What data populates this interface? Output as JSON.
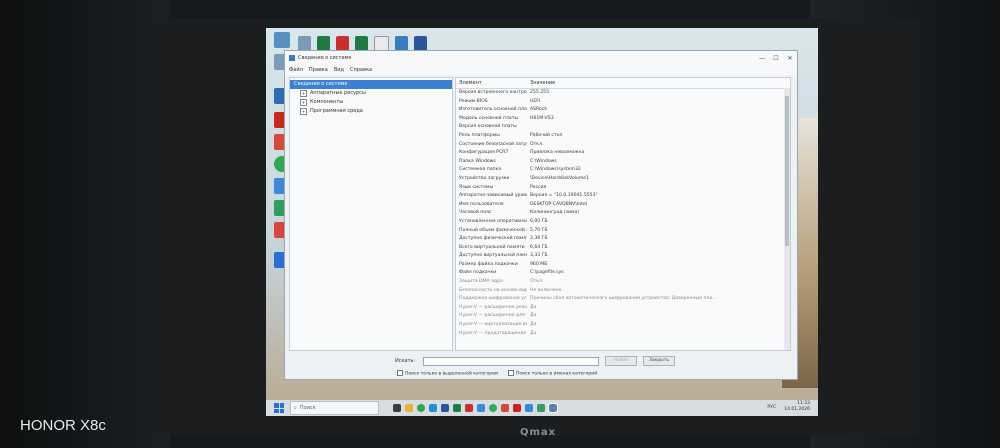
{
  "window": {
    "title": "Сведения о системе",
    "menu": [
      "Файл",
      "Правка",
      "Вид",
      "Справка"
    ]
  },
  "tree": [
    {
      "label": "Сведения о системе",
      "selected": true,
      "level": 0
    },
    {
      "label": "Аппаратные ресурсы",
      "selected": false,
      "level": 1,
      "expander": "+"
    },
    {
      "label": "Компоненты",
      "selected": false,
      "level": 1,
      "expander": "+"
    },
    {
      "label": "Программная среда",
      "selected": false,
      "level": 1,
      "expander": "+"
    }
  ],
  "grid": {
    "headers": [
      "Элемент",
      "Значение"
    ],
    "rows": [
      [
        "Версия встроенного контроля...",
        "255.255"
      ],
      [
        "Режим BIOS",
        "UEFI"
      ],
      [
        "Изготовитель основной платы",
        "ASRock"
      ],
      [
        "Модель основной платы",
        "H61M-VS3"
      ],
      [
        "Версия основной платы",
        ""
      ],
      [
        "Роль платформы",
        "Рабочий стол"
      ],
      [
        "Состояние безопасной загру...",
        "Откл."
      ],
      [
        "Конфигурация PCR7",
        "Привязка невозможна"
      ],
      [
        "Папка Windows",
        "C:\\Windows"
      ],
      [
        "Системная папка",
        "C:\\Windows\\system32"
      ],
      [
        "Устройство загрузки",
        "\\Device\\HarddiskVolume1"
      ],
      [
        "Язык системы",
        "Россия"
      ],
      [
        "Аппаратно-зависимый уровен...",
        "Версия = \"10.0.19041.5553\""
      ],
      [
        "Имя пользователя",
        "DESKTOP-CAVQBNV\\Intel"
      ],
      [
        "Часовой пояс",
        "Калининград (зима)"
      ],
      [
        "Установленная оперативная п...",
        "6,00 ГБ"
      ],
      [
        "Полный объем физической па...",
        "5,70 ГБ"
      ],
      [
        "Доступно физической памяти",
        "2,36 ГБ"
      ],
      [
        "Всего виртуальной памяти",
        "6,64 ГБ"
      ],
      [
        "Доступно виртуальной памяти",
        "3,33 ГБ"
      ],
      [
        "Размер файла подкачки",
        "960 МБ"
      ],
      [
        "Файл подкачки",
        "C:\\pagefile.sys"
      ],
      [
        "Защита DMA ядра",
        "Откл."
      ],
      [
        "Безопасность на основе вирту...",
        "Не включено"
      ],
      [
        "Поддержка шифрования устр...",
        "Причины сбоя автоматического шифрования устройства: Доверенный пла..."
      ],
      [
        "Hyper-V — расширения режи...",
        "Да"
      ],
      [
        "Hyper-V — расширения для т...",
        "Да"
      ],
      [
        "Hyper-V — виртуализация вкл...",
        "Да"
      ],
      [
        "Hyper-V — предотвращение в...",
        "Да"
      ]
    ]
  },
  "find": {
    "label": "Искать:",
    "value": "",
    "find_button": "Найти",
    "close_button": "Закрыть",
    "check_selected": "Поиск только в выделенной категории",
    "check_names": "Поиск только в именах категорий"
  },
  "taskbar": {
    "search_placeholder": "Поиск",
    "time": "11:33",
    "date": "14.01.2026",
    "lang": "РУС"
  },
  "device": {
    "watermark": "HONOR X8c",
    "monitor_brand": "Qmax"
  },
  "colors": {
    "selection": "#3d7fd1",
    "accent": "#2a6fd1"
  }
}
